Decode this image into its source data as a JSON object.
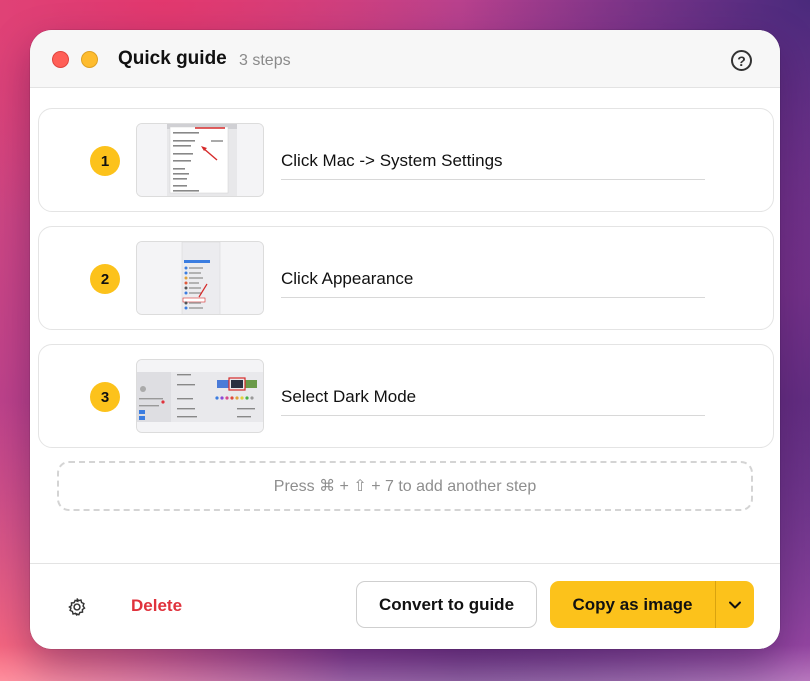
{
  "window": {
    "title": "Quick guide",
    "subtitle": "3 steps",
    "help_glyph": "?"
  },
  "steps": [
    {
      "number": "1",
      "label": "Click Mac -> System Settings",
      "thumbnail": "apple-menu-screenshot"
    },
    {
      "number": "2",
      "label": "Click Appearance",
      "thumbnail": "settings-sidebar-screenshot"
    },
    {
      "number": "3",
      "label": "Select Dark Mode",
      "thumbnail": "appearance-pane-screenshot"
    }
  ],
  "add_step_hint": "Press ⌘ + ⇧ + 7 to add another step",
  "footer": {
    "delete_label": "Delete",
    "convert_label": "Convert to guide",
    "copy_label": "Copy as image"
  },
  "icons": {
    "settings": "gear-icon",
    "help": "question-circle-icon",
    "dropdown": "chevron-down-icon"
  },
  "colors": {
    "accent": "#fcc21b",
    "danger": "#e0323c",
    "close": "#ff5f57",
    "minimize": "#febc2e"
  }
}
